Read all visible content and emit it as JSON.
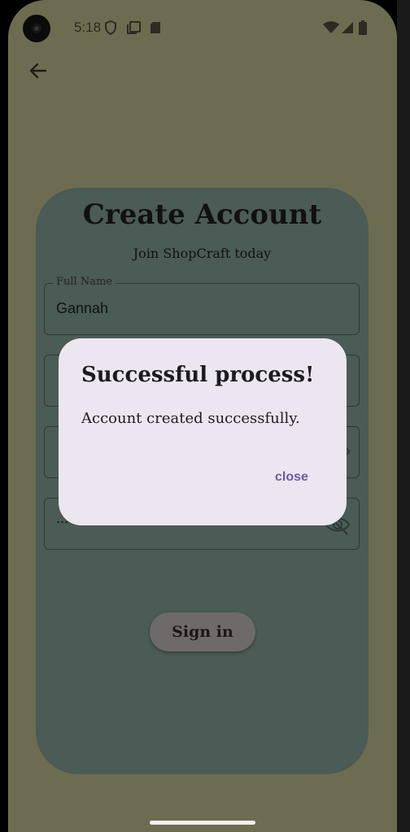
{
  "status_bar": {
    "time": "5:18"
  },
  "card": {
    "title": "Create Account",
    "subtitle": "Join ShopCraft today",
    "fields": [
      {
        "label": "Full Name",
        "value": "Gannah"
      },
      {
        "label": "",
        "value": ""
      },
      {
        "label": "",
        "value": ""
      },
      {
        "label": "",
        "value": "..."
      }
    ],
    "signin_label": "Sign in"
  },
  "dialog": {
    "title": "Successful process!",
    "message": "Account created successfully.",
    "close_label": "close"
  },
  "colors": {
    "screen_bg": "#6e6c50",
    "card_bg": "#4b5b56",
    "dialog_bg": "#ebe6ef",
    "accent": "#6a5aa8"
  }
}
